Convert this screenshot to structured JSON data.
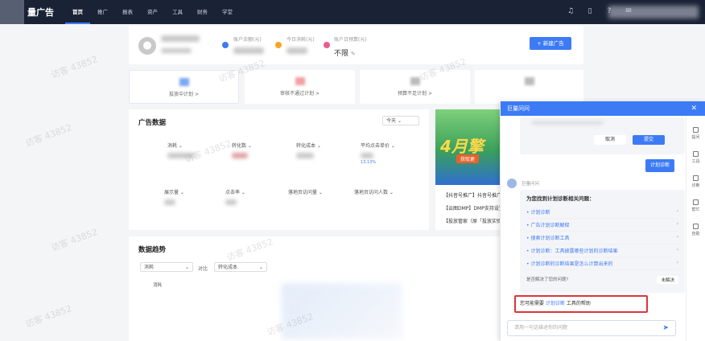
{
  "topbar": {
    "brand": "量广告",
    "nav": [
      "首页",
      "推广",
      "报表",
      "资产",
      "工具",
      "财务",
      "学堂"
    ]
  },
  "account": {
    "balance_label": "账户余额(元)",
    "today_cost_label": "今日消耗(元)",
    "daily_budget_label": "账户日预算(元)",
    "daily_budget_value": "不限",
    "new_ad_button": "+ 新建广告"
  },
  "quick": [
    "投放中计划 >",
    "审核不通过计划 >",
    "预算不足计划 >"
  ],
  "ad_data": {
    "title": "广告数据",
    "range": "今天",
    "metrics_row1": [
      "消耗",
      "转化数",
      "转化成本",
      "平均点击单价"
    ],
    "metrics_row2": [
      "展示量",
      "点击率",
      "落地页访问量",
      "落地页访问人数"
    ],
    "percent": "13.13%"
  },
  "banner": {
    "text": "4月擎",
    "sub": "获取更"
  },
  "news": [
    "【抖音号推广】抖音号推广",
    "【云图DMP】DMP支持设置",
    "【投放管家（原「投放实验"
  ],
  "trend": {
    "title": "数据趋势",
    "sel1": "消耗",
    "compare": "对比",
    "sel2": "转化成本",
    "legend": "消耗"
  },
  "watermark": "访客 43852",
  "chat": {
    "title": "巨量问问",
    "cancel": "取消",
    "submit": "提交",
    "user_msg": "计划诊断",
    "bot_name": "巨量问问",
    "intro": "为您找到计划诊断相关问题：",
    "questions": [
      "计划诊断",
      "广告计划诊断解释",
      "搜索计划诊断工具",
      "计划诊断：工具披露哪些计划的诊断结果",
      "计划诊断的诊断结果是怎么计算出来的"
    ],
    "solved_q": "是否解决了您的问题?",
    "unsolved": "未解决",
    "hint_prefix": "您可能需要",
    "hint_link": "计划诊断",
    "hint_suffix": "工具的帮助",
    "input_placeholder": "请用一句话描述你的问题",
    "side": [
      "提问",
      "工具",
      "诊断",
      "帮忙",
      "自助"
    ]
  }
}
